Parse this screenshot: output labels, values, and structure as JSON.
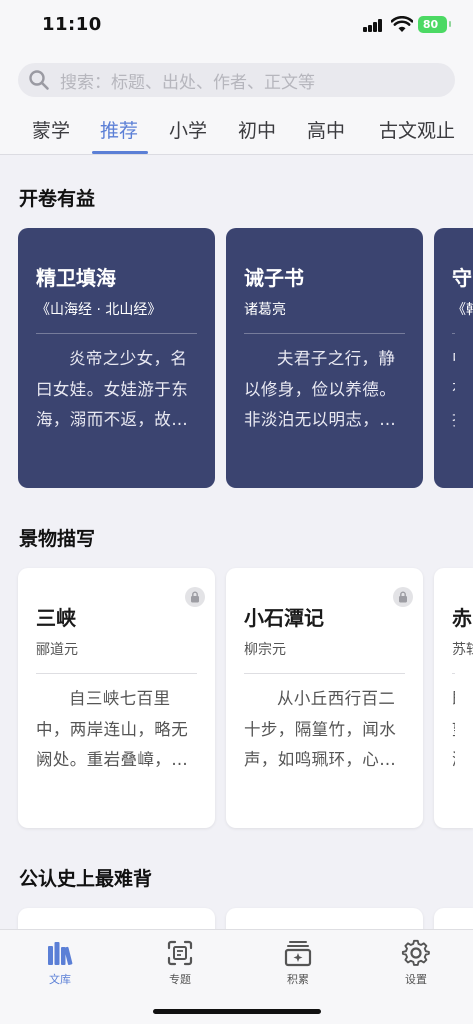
{
  "status": {
    "time": "11:10",
    "battery": "80"
  },
  "search": {
    "placeholder": "搜索：标题、出处、作者、正文等"
  },
  "tabs": [
    {
      "label": "蒙学"
    },
    {
      "label": "推荐",
      "active": true
    },
    {
      "label": "小学"
    },
    {
      "label": "初中"
    },
    {
      "label": "高中"
    },
    {
      "label": "古文观止"
    }
  ],
  "sections": [
    {
      "title": "开卷有益",
      "style": "dark",
      "cards": [
        {
          "title": "精卫填海",
          "source": "《山海经 · 北山经》",
          "excerpt": "炎帝之少女，名曰女娃。女娃游于东海，溺而不返，故…",
          "locked": false
        },
        {
          "title": "诫子书",
          "source": "诸葛亮",
          "excerpt": "夫君子之行，静以修身，俭以养德。非淡泊无以明志，…",
          "locked": false
        },
        {
          "title": "守",
          "source": "《韩",
          "excerpt": "中有折颈",
          "locked": false
        }
      ]
    },
    {
      "title": "景物描写",
      "style": "light",
      "cards": [
        {
          "title": "三峡",
          "source": "郦道元",
          "excerpt": "自三峡七百里中，两岸连山，略无阙处。重岩叠嶂，…",
          "locked": true
        },
        {
          "title": "小石潭记",
          "source": "柳宗元",
          "excerpt": "从小丘西行百二十步，隔篁竹，闻水声，如鸣珮环，心…",
          "locked": true
        },
        {
          "title": "赤",
          "source": "苏轼",
          "excerpt": "既望游于",
          "locked": true
        }
      ]
    },
    {
      "title": "公认史上最难背",
      "style": "light",
      "cards": []
    }
  ],
  "tabbar": [
    {
      "label": "文库",
      "icon": "library-icon",
      "active": true
    },
    {
      "label": "专题",
      "icon": "topic-scan-icon",
      "active": false
    },
    {
      "label": "积累",
      "icon": "collection-box-icon",
      "active": false
    },
    {
      "label": "设置",
      "icon": "gear-icon",
      "active": false
    }
  ],
  "colors": {
    "accent": "#5b7fd6",
    "dark_card": "#3b4470",
    "battery": "#4cd964"
  }
}
